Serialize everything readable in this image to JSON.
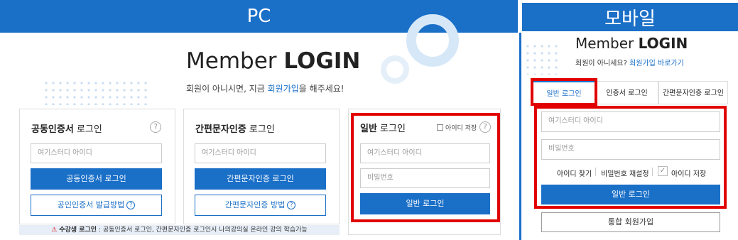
{
  "headers": {
    "pc": "PC",
    "mobile": "모바일"
  },
  "pc": {
    "title_prefix": "Member ",
    "title_bold": "LOGIN",
    "subtitle_before": "회원이 아니시면, 지금 ",
    "subtitle_link": "회원가입",
    "subtitle_after": "을 해주세요!",
    "cards": {
      "cert": {
        "title_bold": "공동인증서",
        "title_rest": " 로그인",
        "help": "?",
        "id_placeholder": "여기스터디 아이디",
        "login_button": "공동인증서 로그인",
        "issue_button": "공인인증서 발급방법"
      },
      "simple": {
        "title_bold": "간편문자인증",
        "title_rest": " 로그인",
        "id_placeholder": "여기스터디 아이디",
        "login_button": "간편문자인증 로그인",
        "method_button": "간편문자인증 방법"
      },
      "general": {
        "title_bold": "일반",
        "title_rest": " 로그인",
        "save_id_label": "아이디 저장",
        "help": "?",
        "id_placeholder": "여기스터디 아이디",
        "pw_placeholder": "비밀번호",
        "login_button": "일반 로그인"
      }
    },
    "notice": {
      "icon": "⚠",
      "bold": "수강생 로그인",
      "text": " : 공동인증서 로그인, 간편문자인증 로그인시 나의강의실 온라인 강의 학습가능"
    }
  },
  "mobile": {
    "title_prefix": "Member ",
    "title_bold": "LOGIN",
    "subtitle_text": "회원이 아니세요? ",
    "subtitle_link": "회원가입 바로가기",
    "tabs": [
      "일반 로그인",
      "인증서 로그인",
      "간편문자인증 로그인"
    ],
    "id_placeholder": "여기스터디 아이디",
    "pw_placeholder": "비밀번호",
    "find_id": "아이디 찾기",
    "reset_pw": "비밀번호 재설정",
    "save_id": "아이디 저장",
    "login_button": "일반 로그인",
    "join_button": "통합 회원가입"
  },
  "colors": {
    "brand_blue": "#1a6fc7",
    "highlight_red": "#e10000"
  }
}
